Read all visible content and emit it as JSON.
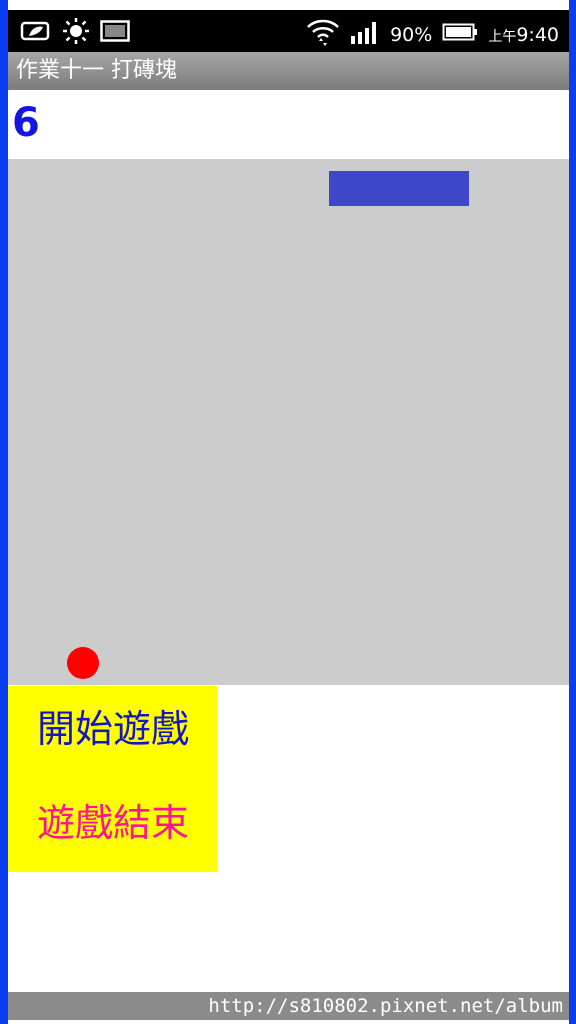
{
  "status_bar": {
    "battery_percent": "90%",
    "time_prefix": "上午",
    "time": "9:40",
    "icons": [
      "battery-saver-icon",
      "brightness-icon",
      "screenshot-icon",
      "wifi-icon",
      "signal-icon",
      "battery-icon"
    ]
  },
  "app": {
    "title": "作業十一 打磚塊"
  },
  "game": {
    "score": "6",
    "paddle_color": "#3d47c8",
    "ball_color": "#ff0000",
    "field_color": "#cccccc"
  },
  "menu": {
    "start_label": "開始遊戲",
    "end_label": "遊戲結束"
  },
  "watermark": {
    "text": "http://s810802.pixnet.net/album"
  }
}
